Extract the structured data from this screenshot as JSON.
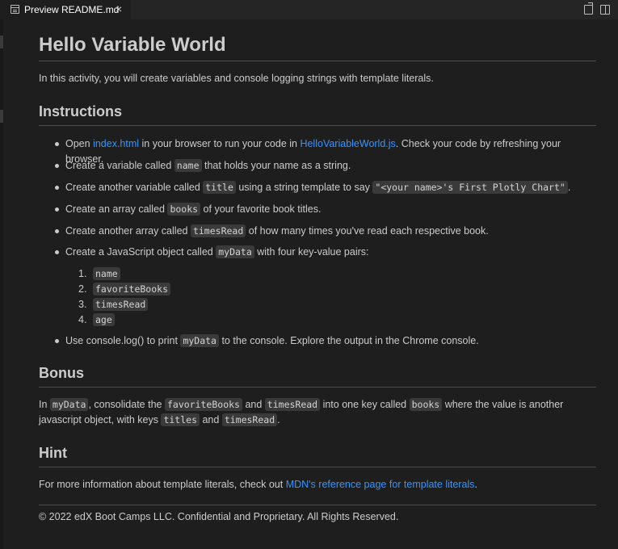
{
  "tab": {
    "label": "Preview README.md",
    "close": "×"
  },
  "doc": {
    "title": "Hello Variable World",
    "intro": "In this activity, you will create variables and console logging strings with template literals.",
    "instructions_heading": "Instructions",
    "bullets": {
      "b1": {
        "pre": "Open ",
        "link1": "index.html",
        "mid": " in your browser to run your code in ",
        "link2": "HelloVariableWorld.js",
        "post": ". Check your code by refreshing your browser."
      },
      "b2": {
        "pre": "Create a variable called ",
        "code": "name",
        "post": " that holds your name as a string."
      },
      "b3": {
        "pre": "Create another variable called ",
        "code": "title",
        "mid": " using a string template to say ",
        "code2": "\"<your name>'s First Plotly Chart\"",
        "post": "."
      },
      "b4": {
        "pre": "Create an array called ",
        "code": "books",
        "post": " of your favorite book titles."
      },
      "b5": {
        "pre": "Create another array called ",
        "code": "timesRead",
        "post": " of how many times you've read each respective book."
      },
      "b6": {
        "pre": "Create a JavaScript object called ",
        "code": "myData",
        "post": " with four key-value pairs:"
      },
      "b7": {
        "pre": "Use console.log() to print ",
        "code": "myData",
        "post": " to the console. Explore the output in the Chrome console."
      }
    },
    "keys": [
      {
        "num": "1.",
        "key": "name"
      },
      {
        "num": "2.",
        "key": "favoriteBooks"
      },
      {
        "num": "3.",
        "key": "timesRead"
      },
      {
        "num": "4.",
        "key": "age"
      }
    ],
    "bonus_heading": "Bonus",
    "bonus": {
      "t1": "In ",
      "c1": "myData",
      "t2": ", consolidate the ",
      "c2": "favoriteBooks",
      "t3": " and ",
      "c3": "timesRead",
      "t4": " into one key called ",
      "c4": "books",
      "t5": " where the value is another javascript object, with keys ",
      "c5": "titles",
      "t6": " and ",
      "c6": "timesRead",
      "t7": "."
    },
    "hint_heading": "Hint",
    "hint": {
      "pre": "For more information about template literals, check out ",
      "link": "MDN's reference page for template literals",
      "post": "."
    },
    "footer": "© 2022 edX Boot Camps LLC. Confidential and Proprietary. All Rights Reserved."
  }
}
